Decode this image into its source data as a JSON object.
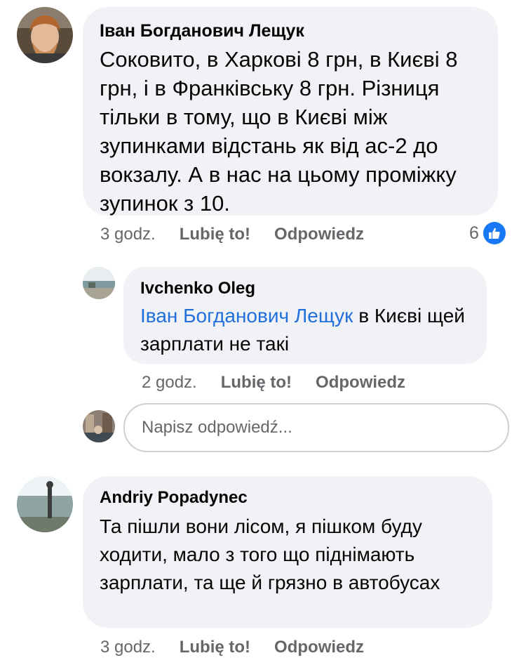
{
  "comments": [
    {
      "author": "Іван Богданович Лещук",
      "text": "Соковито, в Харкові 8 грн, в Києві 8 грн, і в Франківську 8 грн. Різниця тільки в тому, що в Києві між зупинками відстань як від ас-2 до вокзалу. А в нас на цьому проміжку зупинок з 10.",
      "time": "3 godz.",
      "like_label": "Lubię to!",
      "reply_label": "Odpowiedz",
      "like_count": "6",
      "avatar_icon": "profile-photo-bearded-man"
    },
    {
      "author": "Ivchenko Oleg",
      "mention": "Іван Богданович Лещук",
      "text": " в Києві щей зарплати не такі",
      "time": "2 godz.",
      "like_label": "Lubię to!",
      "reply_label": "Odpowiedz",
      "avatar_icon": "profile-photo-seaside"
    },
    {
      "author": "Andriy Popadynec",
      "text": "Та пішли вони лісом, я пішком буду ходити, мало з того що піднімають зарплати, та ще й грязно в автобусах",
      "time": "3 godz.",
      "like_label": "Lubię to!",
      "reply_label": "Odpowiedz",
      "avatar_icon": "profile-photo-landscape"
    }
  ],
  "reply_box": {
    "placeholder": "Napisz odpowiedź...",
    "avatar_icon": "profile-photo-current-user"
  },
  "colors": {
    "bubble": "#f0f2f5",
    "mention": "#216fdb",
    "meta": "#65676b",
    "like_badge": "#1877f2"
  }
}
